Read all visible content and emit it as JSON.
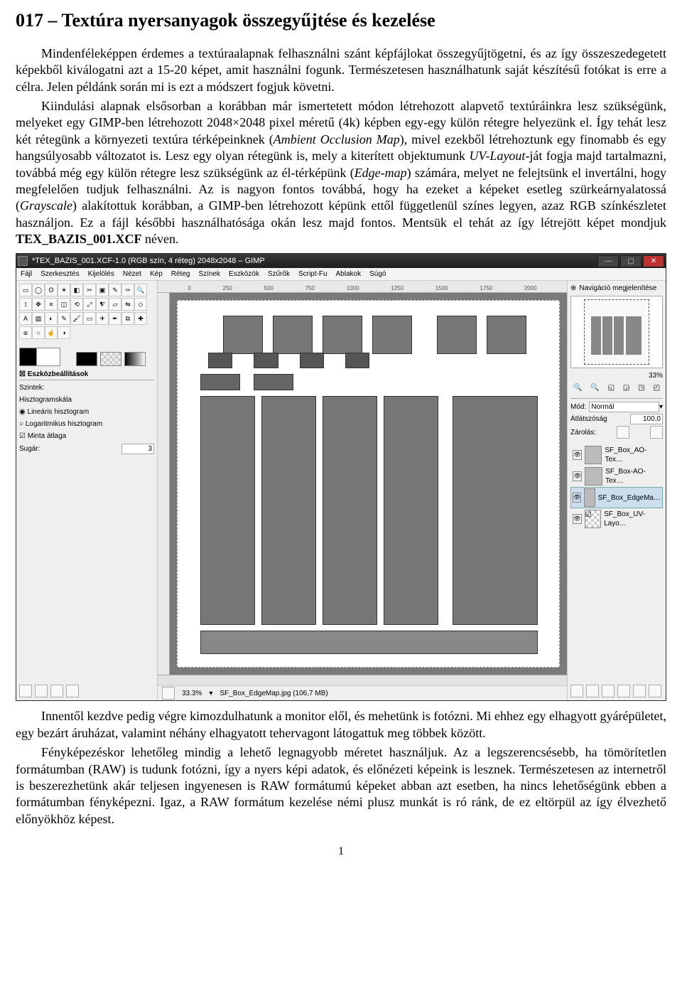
{
  "doc": {
    "title": "017 – Textúra nyersanyagok összegyűjtése és kezelése",
    "p1a": "Mindenféleképpen érdemes a textúraalapnak felhasználni szánt képfájlokat összegyűjtögetni, és az így összeszedegetett képekből kiválogatni azt a 15-20 képet, amit használni fogunk. Természetesen használhatunk saját készítésű fotókat is erre a célra. Jelen példánk során mi is ezt a módszert fogjuk követni.",
    "p1b_a": "Kiindulási alapnak elsősorban a korábban már ismertetett módon létrehozott alapvető textúráinkra lesz szükségünk, melyeket egy GIMP-ben létrehozott 2048×2048 pixel méretű (4k) képben egy-egy külön rétegre helyezünk el. Így tehát lesz két rétegünk a környezeti textúra térképeinknek (",
    "p1b_i1": "Ambient Occlusion Map",
    "p1b_b": "), mivel ezekből létrehoztunk egy finomabb és egy hangsúlyosabb változatot is. Lesz egy olyan rétegünk is, mely a kiterített objektumunk ",
    "p1b_i2": "UV-Layout",
    "p1b_c": "-ját fogja majd tartalmazni, továbbá még egy külön rétegre lesz szükségünk az él-térképünk (",
    "p1b_i3": "Edge-map",
    "p1b_d": ") számára, melyet ne felejtsünk el invertálni, hogy megfelelően tudjuk felhasználni. Az is nagyon fontos továbbá, hogy ha ezeket a képeket esetleg szürkeárnyalatossá (",
    "p1b_i4": "Grayscale",
    "p1b_e": ") alakítottuk korábban, a GIMP-ben létrehozott képünk ettől függetlenül színes legyen, azaz RGB színkészletet használjon. Ez a fájl későbbi használhatósága okán lesz majd fontos. Mentsük el tehát az így létrejött képet mondjuk ",
    "p1b_bold": "TEX_BAZIS_001.XCF",
    "p1b_f": " néven.",
    "p2": "Innentől kezdve pedig végre kimozdulhatunk a monitor elől, és mehetünk is fotózni. Mi ehhez egy elhagyott gyárépületet, egy bezárt áruházat, valamint néhány elhagyatott tehervagont látogattuk meg többek között.",
    "p3": "Fényképezéskor lehetőleg mindig a lehető legnagyobb méretet használjuk. Az a legszerencsésebb, ha tömörítetlen formátumban (RAW) is tudunk fotózni, így a nyers képi adatok, és előnézeti képeink is lesznek. Természetesen az internetről is beszerezhetünk akár teljesen ingyenesen is RAW formátumú képeket abban azt esetben, ha nincs lehetőségünk ebben a formátumban fényképezni. Igaz, a RAW formátum kezelése némi plusz munkát is ró ránk, de ez eltörpül az így élvezhető előnyökhöz képest.",
    "page_number": "1"
  },
  "gimp": {
    "title": "*TEX_BAZIS_001.XCF-1.0 (RGB szín, 4 réteg) 2048x2048 – GIMP",
    "menu": [
      "Fájl",
      "Szerkesztés",
      "Kijelölés",
      "Nézet",
      "Kép",
      "Réteg",
      "Színek",
      "Eszközök",
      "Szűrők",
      "Script-Fu",
      "Ablakok",
      "Súgó"
    ],
    "ruler_marks": [
      "0",
      "250",
      "500",
      "750",
      "1000",
      "1250",
      "1500",
      "1750",
      "2000"
    ],
    "toolbox_title": "Eszközbeállítások",
    "levels_title": "Szintek:",
    "hist_title": "Hisztogramskála",
    "hist_opt1": "Lineáris hisztogram",
    "hist_opt2": "Logaritmikus hisztogram",
    "sample_avg": "Minta átlaga",
    "radius": "Sugár:",
    "radius_val": "3",
    "status_zoom": "33.3%",
    "status_file": "SF_Box_EdgeMap.jpg (106,7 MB)",
    "nav_collapse": "Navigáció megjelenítése",
    "nav_zoom": "33%",
    "mode_label": "Mód:",
    "mode_value": "Normál",
    "opacity_label": "Átlátszóság",
    "opacity_value": "100,0",
    "lock_label": "Zárolás:",
    "layers": [
      {
        "name": "SF_Box_AO-Tex…"
      },
      {
        "name": "SF_Box-AO-Tex…"
      },
      {
        "name": "SF_Box_EdgeMa…"
      },
      {
        "name": "SF_Box_UV-Layo…"
      }
    ],
    "selected_layer": 2
  }
}
